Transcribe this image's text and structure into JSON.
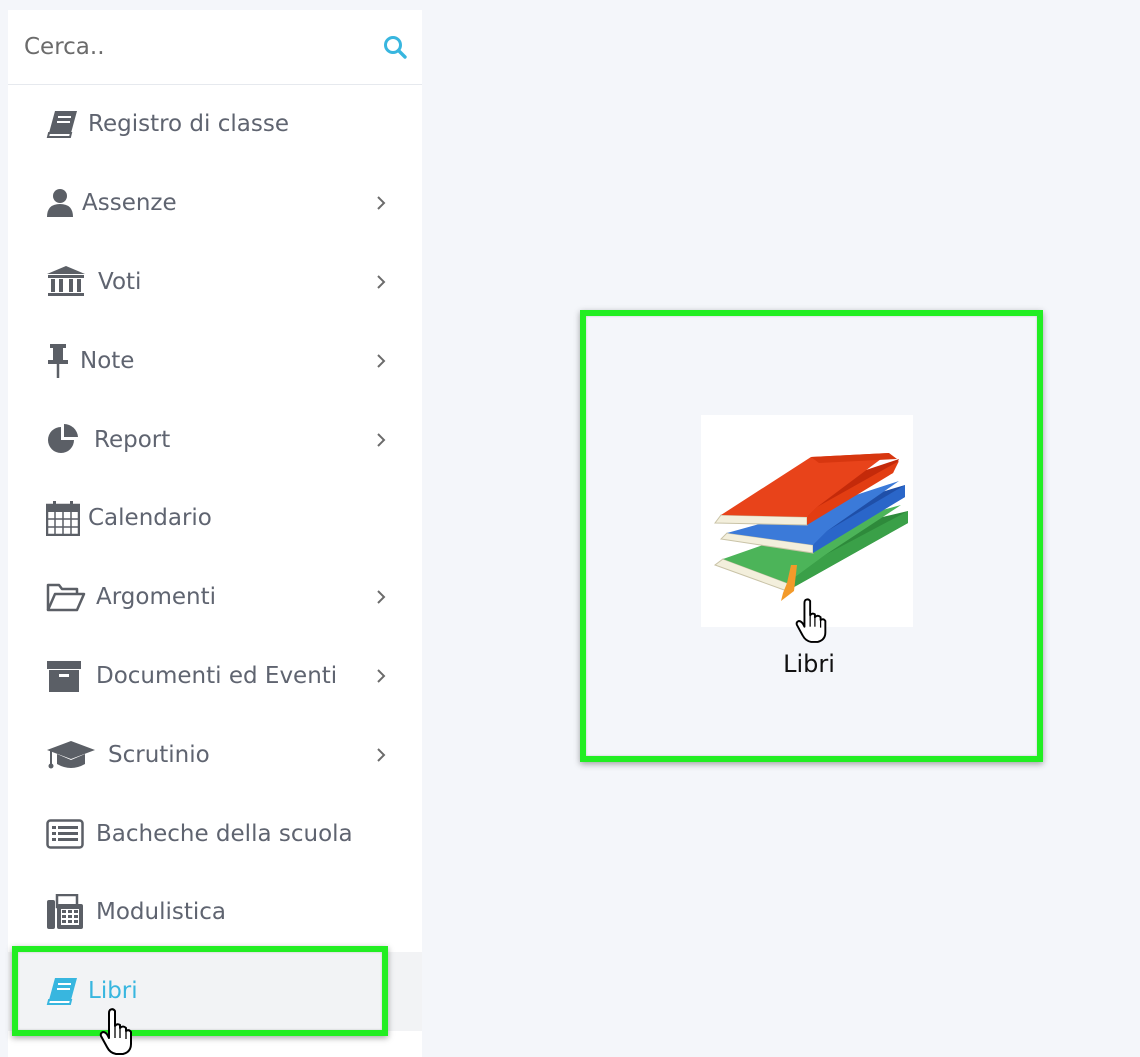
{
  "search": {
    "placeholder": "Cerca.."
  },
  "menu": [
    {
      "label": "Registro di classe",
      "icon": "book-icon",
      "has_submenu": false
    },
    {
      "label": "Assenze",
      "icon": "user-icon",
      "has_submenu": true
    },
    {
      "label": "Voti",
      "icon": "institution-icon",
      "has_submenu": true
    },
    {
      "label": "Note",
      "icon": "pushpin-icon",
      "has_submenu": true
    },
    {
      "label": "Report",
      "icon": "pie-chart-icon",
      "has_submenu": true
    },
    {
      "label": "Calendario",
      "icon": "calendar-icon",
      "has_submenu": false
    },
    {
      "label": "Argomenti",
      "icon": "folder-open-icon",
      "has_submenu": true
    },
    {
      "label": "Documenti ed Eventi",
      "icon": "archive-icon",
      "has_submenu": true
    },
    {
      "label": "Scrutinio",
      "icon": "graduation-cap-icon",
      "has_submenu": true
    },
    {
      "label": "Bacheche della scuola",
      "icon": "list-alt-icon",
      "has_submenu": false
    },
    {
      "label": "Modulistica",
      "icon": "fax-icon",
      "has_submenu": false
    },
    {
      "label": "Libri",
      "icon": "book-icon",
      "has_submenu": false,
      "active": true
    }
  ],
  "tile": {
    "label": "Libri",
    "icon": "books-stack-icon"
  },
  "colors": {
    "highlight": "#22ee22",
    "active_text": "#38b6df",
    "menu_text": "#5f6470",
    "icon_gray": "#5b5f66",
    "background": "#f4f6fa"
  }
}
